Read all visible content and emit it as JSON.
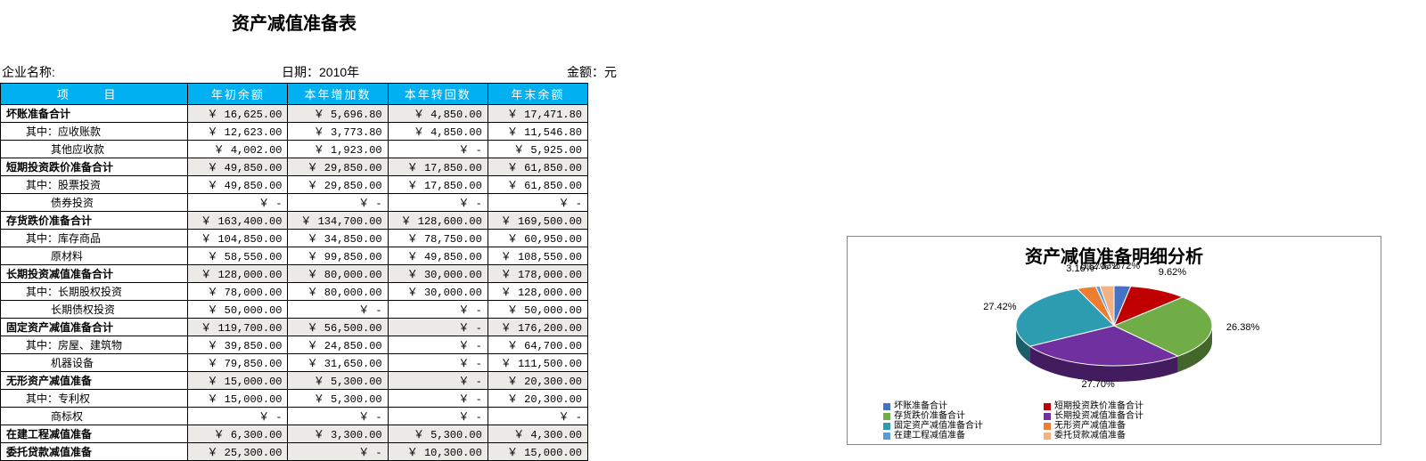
{
  "title": "资产减值准备表",
  "meta": {
    "company_label": "企业名称:",
    "date_label": "日期：2010年",
    "unit_label": "金额：元"
  },
  "headers": [
    "项    目",
    "年初余额",
    "本年增加数",
    "本年转回数",
    "年末余额"
  ],
  "rows": [
    {
      "bold": true,
      "indent": 0,
      "item": "坏账准备合计",
      "shade": true,
      "v": [
        "￥ 16,625.00",
        "￥ 5,696.80",
        "￥ 4,850.00",
        "￥ 17,471.80"
      ]
    },
    {
      "bold": false,
      "indent": 1,
      "item": "其中：应收账款",
      "shade": false,
      "v": [
        "￥ 12,623.00",
        "￥ 3,773.80",
        "￥ 4,850.00",
        "￥ 11,546.80"
      ]
    },
    {
      "bold": false,
      "indent": 2,
      "item": "其他应收款",
      "shade": false,
      "v": [
        "￥ 4,002.00",
        "￥ 1,923.00",
        "￥ -",
        "￥ 5,925.00"
      ]
    },
    {
      "bold": true,
      "indent": 0,
      "item": "短期投资跌价准备合计",
      "shade": true,
      "v": [
        "￥ 49,850.00",
        "￥ 29,850.00",
        "￥ 17,850.00",
        "￥ 61,850.00"
      ]
    },
    {
      "bold": false,
      "indent": 1,
      "item": "其中：股票投资",
      "shade": false,
      "v": [
        "￥ 49,850.00",
        "￥ 29,850.00",
        "￥ 17,850.00",
        "￥ 61,850.00"
      ]
    },
    {
      "bold": false,
      "indent": 2,
      "item": "债券投资",
      "shade": false,
      "v": [
        "￥ -",
        "￥ -",
        "￥ -",
        "￥ -"
      ]
    },
    {
      "bold": true,
      "indent": 0,
      "item": "存货跌价准备合计",
      "shade": true,
      "v": [
        "￥ 163,400.00",
        "￥ 134,700.00",
        "￥ 128,600.00",
        "￥ 169,500.00"
      ]
    },
    {
      "bold": false,
      "indent": 1,
      "item": "其中：库存商品",
      "shade": false,
      "v": [
        "￥ 104,850.00",
        "￥ 34,850.00",
        "￥ 78,750.00",
        "￥ 60,950.00"
      ]
    },
    {
      "bold": false,
      "indent": 2,
      "item": "原材料",
      "shade": false,
      "v": [
        "￥ 58,550.00",
        "￥ 99,850.00",
        "￥ 49,850.00",
        "￥ 108,550.00"
      ]
    },
    {
      "bold": true,
      "indent": 0,
      "item": "长期投资减值准备合计",
      "shade": true,
      "v": [
        "￥ 128,000.00",
        "￥ 80,000.00",
        "￥ 30,000.00",
        "￥ 178,000.00"
      ]
    },
    {
      "bold": false,
      "indent": 1,
      "item": "其中：长期股权投资",
      "shade": false,
      "v": [
        "￥ 78,000.00",
        "￥ 80,000.00",
        "￥ 30,000.00",
        "￥ 128,000.00"
      ]
    },
    {
      "bold": false,
      "indent": 2,
      "item": "长期债权投资",
      "shade": false,
      "v": [
        "￥ 50,000.00",
        "￥ -",
        "￥ -",
        "￥ 50,000.00"
      ]
    },
    {
      "bold": true,
      "indent": 0,
      "item": "固定资产减值准备合计",
      "shade": true,
      "v": [
        "￥ 119,700.00",
        "￥ 56,500.00",
        "￥ -",
        "￥ 176,200.00"
      ]
    },
    {
      "bold": false,
      "indent": 1,
      "item": "其中：房屋、建筑物",
      "shade": false,
      "v": [
        "￥ 39,850.00",
        "￥ 24,850.00",
        "￥ -",
        "￥ 64,700.00"
      ]
    },
    {
      "bold": false,
      "indent": 2,
      "item": "机器设备",
      "shade": false,
      "v": [
        "￥ 79,850.00",
        "￥ 31,650.00",
        "￥ -",
        "￥ 111,500.00"
      ]
    },
    {
      "bold": true,
      "indent": 0,
      "item": "无形资产减值准备",
      "shade": true,
      "v": [
        "￥ 15,000.00",
        "￥ 5,300.00",
        "￥ -",
        "￥ 20,300.00"
      ]
    },
    {
      "bold": false,
      "indent": 1,
      "item": "其中：专利权",
      "shade": false,
      "v": [
        "￥ 15,000.00",
        "￥ 5,300.00",
        "￥ -",
        "￥ 20,300.00"
      ]
    },
    {
      "bold": false,
      "indent": 2,
      "item": "商标权",
      "shade": false,
      "v": [
        "￥ -",
        "￥ -",
        "￥ -",
        "￥ -"
      ]
    },
    {
      "bold": true,
      "indent": 0,
      "item": "在建工程减值准备",
      "shade": true,
      "v": [
        "￥ 6,300.00",
        "￥ 3,300.00",
        "￥ 5,300.00",
        "￥ 4,300.00"
      ]
    },
    {
      "bold": true,
      "indent": 0,
      "item": "委托贷款减值准备",
      "shade": true,
      "v": [
        "￥ 25,300.00",
        "￥ -",
        "￥ 10,300.00",
        "￥ 15,000.00"
      ]
    }
  ],
  "chart_data": {
    "type": "pie",
    "title": "资产减值准备明细分析",
    "series": [
      {
        "name": "坏账准备合计",
        "pct": 2.72,
        "color": "#4472c4"
      },
      {
        "name": "短期投资跌价准备合计",
        "pct": 9.62,
        "color": "#c00000"
      },
      {
        "name": "存货跌价准备合计",
        "pct": 26.38,
        "color": "#70ad47"
      },
      {
        "name": "长期投资减值准备合计",
        "pct": 27.7,
        "color": "#7030a0"
      },
      {
        "name": "固定资产减值准备合计",
        "pct": 27.42,
        "color": "#2e9cb0"
      },
      {
        "name": "无形资产减值准备",
        "pct": 3.16,
        "color": "#ed7d31"
      },
      {
        "name": "在建工程减值准备",
        "pct": 0.67,
        "color": "#5b9bd5"
      },
      {
        "name": "委托贷款减值准备",
        "pct": 2.33,
        "color": "#f4b183"
      }
    ]
  }
}
